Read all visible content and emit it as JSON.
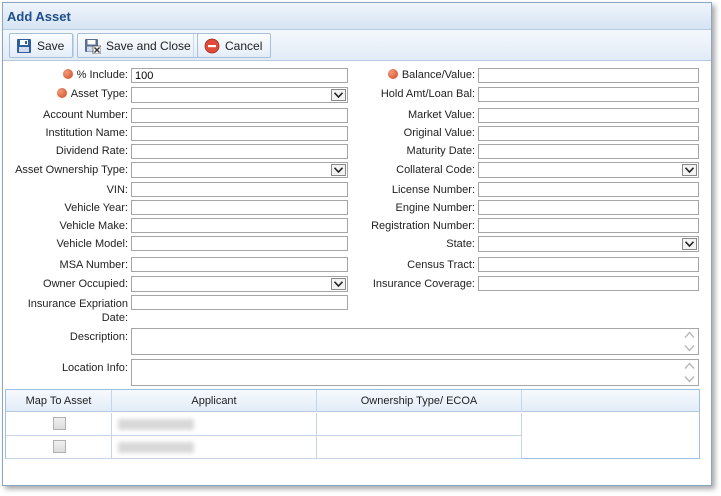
{
  "dialog": {
    "title": "Add Asset"
  },
  "toolbar": {
    "save_label": "Save",
    "save_close_label": "Save and Close",
    "cancel_label": "Cancel"
  },
  "left": {
    "include_label": "% Include:",
    "include_value": "100",
    "asset_type_label": "Asset Type:",
    "account_number_label": "Account Number:",
    "institution_name_label": "Institution Name:",
    "dividend_rate_label": "Dividend Rate:",
    "ownership_type_label": "Asset Ownership Type:",
    "vin_label": "VIN:",
    "vehicle_year_label": "Vehicle Year:",
    "vehicle_make_label": "Vehicle Make:",
    "vehicle_model_label": "Vehicle Model:",
    "msa_number_label": "MSA Number:",
    "owner_occupied_label": "Owner Occupied:",
    "insurance_exp_label_1": "Insurance Expriation",
    "insurance_exp_label_2": "Date:"
  },
  "right": {
    "balance_label": "Balance/Value:",
    "hold_amt_label": "Hold Amt/Loan Bal:",
    "market_value_label": "Market Value:",
    "original_value_label": "Original Value:",
    "maturity_date_label": "Maturity Date:",
    "collateral_code_label": "Collateral Code:",
    "license_number_label": "License Number:",
    "engine_number_label": "Engine Number:",
    "registration_number_label": "Registration Number:",
    "state_label": "State:",
    "census_tract_label": "Census Tract:",
    "insurance_coverage_label": "Insurance Coverage:"
  },
  "description_label": "Description:",
  "location_label": "Location Info:",
  "grid": {
    "columns": [
      "Map To Asset",
      "Applicant",
      "Ownership Type/ ECOA"
    ]
  }
}
